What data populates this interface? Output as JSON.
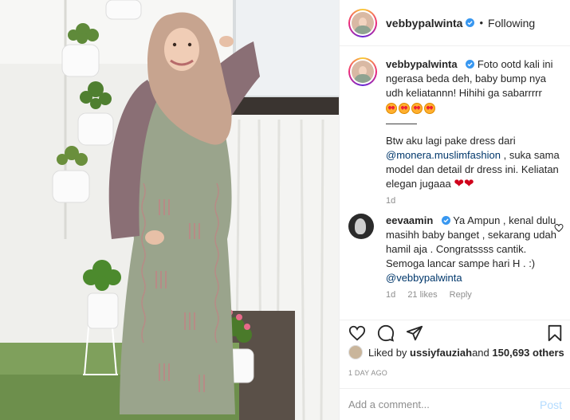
{
  "post": {
    "username": "vebbypalwinta",
    "follow_status": "Following",
    "caption": {
      "line1": "Foto ootd kali ini ngerasa beda deh, baby bump nya udh keliatannn! Hihihi ga sabarrrrr",
      "separator": "———",
      "line2_before": "Btw aku lagi pake dress dari ",
      "mention": "@monera.muslimfashion",
      "line2_after": " , suka sama model dan detail dr dress ini. Keliatan elegan jugaaa",
      "time": "1d"
    },
    "comment": {
      "username": "eevaamin",
      "text": "Ya Ampun , kenal dulu masihh baby banget , sekarang udah hamil aja . Congratssss cantik. Semoga lancar sampe hari H . :)",
      "mention": "@vebbypalwinta",
      "time": "1d",
      "likes": "21 likes",
      "reply": "Reply"
    },
    "liked_by": {
      "prefix": "Liked by ",
      "user": "ussiyfauziah",
      "middle": " and ",
      "count": "150,693 others"
    },
    "date": "1 DAY AGO",
    "add_comment_placeholder": "Add a comment...",
    "post_button": "Post"
  },
  "icons": {
    "verified": "verified-badge-icon",
    "like": "heart-icon",
    "comment": "comment-bubble-icon",
    "share": "paper-plane-icon",
    "save": "bookmark-icon"
  },
  "colors": {
    "verified_blue": "#3897f0",
    "mention": "#00376b",
    "muted": "#8e8e8e",
    "post_button": "#b3dbff"
  }
}
